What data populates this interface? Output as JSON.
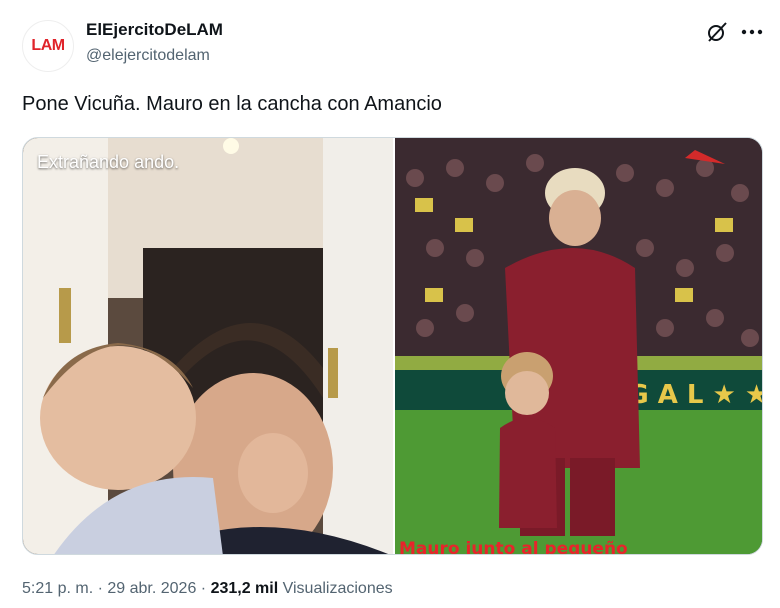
{
  "author": {
    "avatar_text": "LAM",
    "name": "ElEjercitoDeLAM",
    "handle": "@elejercitodelam"
  },
  "icons": {
    "grok": "grok-slash-icon",
    "more": "more-dots-icon"
  },
  "tweet": {
    "text": "Pone Vicuña. Mauro en la cancha con Amancio"
  },
  "media": {
    "left_caption": "Extrañando ando.",
    "right_banner_text": "Mauro junto al pequeño"
  },
  "footer": {
    "time": "5:21 p. m.",
    "sep1": " · ",
    "date": "29 abr. 2026",
    "sep2": " · ",
    "views_count": "231,2 mil",
    "views_label": " Visualizaciones"
  },
  "colors": {
    "brand_red": "#e0242b",
    "muted": "#536471",
    "text": "#0f1419"
  }
}
